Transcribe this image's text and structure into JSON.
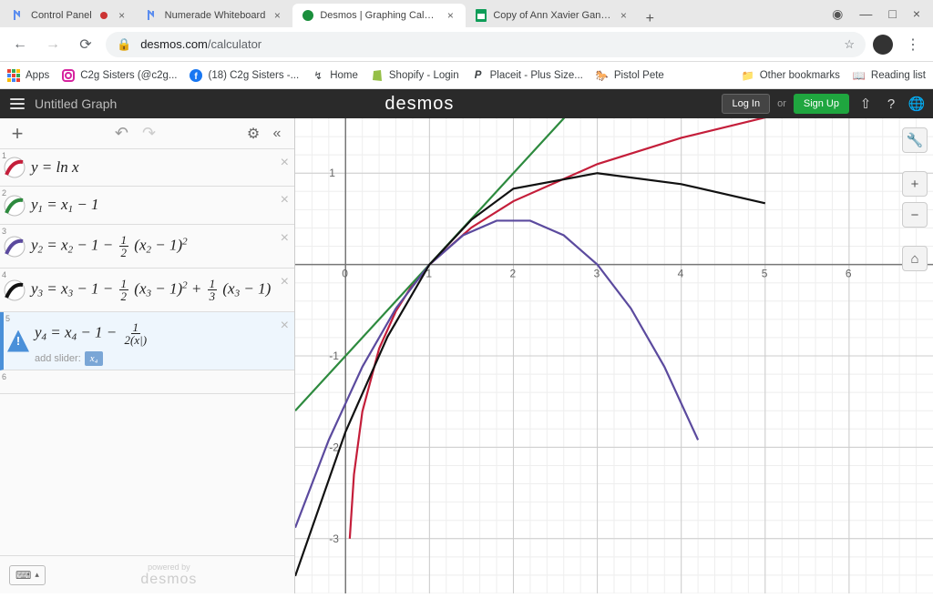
{
  "browser": {
    "tabs": [
      {
        "title": "Control Panel",
        "kind": "numerade"
      },
      {
        "title": "Numerade Whiteboard",
        "kind": "numerade"
      },
      {
        "title": "Desmos | Graphing Calculator",
        "kind": "desmos",
        "active": true
      },
      {
        "title": "Copy of Ann Xavier Gantert - A",
        "kind": "gdoc"
      }
    ],
    "url_host": "desmos.com",
    "url_path": "/calculator",
    "bookmarks": {
      "apps": "Apps",
      "items": [
        "C2g Sisters (@c2g...",
        "(18) C2g Sisters -...",
        "Home",
        "Shopify - Login",
        "Placeit - Plus Size...",
        "Pistol Pete"
      ],
      "other": "Other bookmarks",
      "reading": "Reading list"
    }
  },
  "desmos": {
    "graph_title": "Untitled Graph",
    "brand": "desmos",
    "login": "Log In",
    "or": "or",
    "signup": "Sign Up"
  },
  "rows": [
    {
      "eq_html": "<i>y</i> = ln <i>x</i>",
      "color": "#c41e3a"
    },
    {
      "eq_html": "<i>y</i><span class='sub'>1</span> = <i>x</i><span class='sub'>1</span> − 1",
      "color": "#2d8a3e"
    },
    {
      "eq_html": "<i>y</i><span class='sub'>2</span> = <i>x</i><span class='sub'>2</span> − 1 − <span class='fr'><span class='n'>1</span><span class='d'>2</span></span> (<i>x</i><span class='sub'>2</span> − 1)<span class='sup'>2</span>",
      "color": "#5b4a9e"
    },
    {
      "eq_html": "<i>y</i><span class='sub'>3</span> = <i>x</i><span class='sub'>3</span> − 1 − <span class='fr'><span class='n'>1</span><span class='d'>2</span></span> (<i>x</i><span class='sub'>3</span> − 1)<span class='sup'>2</span> + <span class='fr'><span class='n'>1</span><span class='d'>3</span></span> (<i>x</i><span class='sub'>3</span> − 1)",
      "color": "#111"
    },
    {
      "eq_html": "<i>y</i><span class='sub'>4</span> = <i>x</i><span class='sub'>4</span> − 1 − <span class='fr'><span class='n'>1</span><span class='d'>2(<i>x</i>|)</span></span>",
      "warn": true
    }
  ],
  "slider": {
    "label": "add slider:",
    "chip": "x₄"
  },
  "footer": {
    "powered": "powered by",
    "brand": "desmos"
  },
  "axis": {
    "x_ticks": [
      0,
      1,
      2,
      3,
      4,
      5,
      6
    ],
    "y_ticks": [
      1,
      -1,
      -2,
      -3
    ]
  },
  "chart_data": {
    "type": "line",
    "xlim": [
      -0.6,
      7.0
    ],
    "ylim": [
      -3.6,
      1.6
    ],
    "x_ticks": [
      0,
      1,
      2,
      3,
      4,
      5,
      6
    ],
    "y_ticks": [
      -3,
      -2,
      -1,
      1
    ],
    "series": [
      {
        "name": "y = ln x",
        "color": "#c41e3a",
        "x": [
          0.05,
          0.1,
          0.2,
          0.4,
          0.6,
          0.8,
          1,
          1.5,
          2,
          3,
          4,
          5,
          6,
          7
        ],
        "y": [
          -3.0,
          -2.3,
          -1.61,
          -0.92,
          -0.51,
          -0.22,
          0,
          0.405,
          0.693,
          1.099,
          1.386,
          1.609,
          1.792,
          1.946
        ]
      },
      {
        "name": "y1 = x - 1",
        "color": "#2d8a3e",
        "x": [
          -0.6,
          7
        ],
        "y": [
          -1.6,
          6
        ]
      },
      {
        "name": "y2 = (x-1) - 0.5(x-1)^2",
        "color": "#5b4a9e",
        "x": [
          -0.6,
          -0.2,
          0.2,
          0.6,
          1,
          1.4,
          1.8,
          2.2,
          2.6,
          3,
          3.4,
          3.8,
          4.2
        ],
        "y": [
          -2.88,
          -1.92,
          -1.12,
          -0.48,
          0,
          0.32,
          0.48,
          0.48,
          0.32,
          0,
          -0.48,
          -1.12,
          -1.92
        ]
      },
      {
        "name": "y3 = (x-1) - 0.5(x-1)^2 + (1/3)(x-1)",
        "color": "#111",
        "x": [
          -0.6,
          0,
          0.5,
          1,
          1.5,
          2,
          3,
          4,
          5
        ],
        "y": [
          -3.41,
          -1.83,
          -0.79,
          0,
          0.49,
          0.83,
          1.0,
          0.88,
          0.67
        ]
      }
    ]
  }
}
